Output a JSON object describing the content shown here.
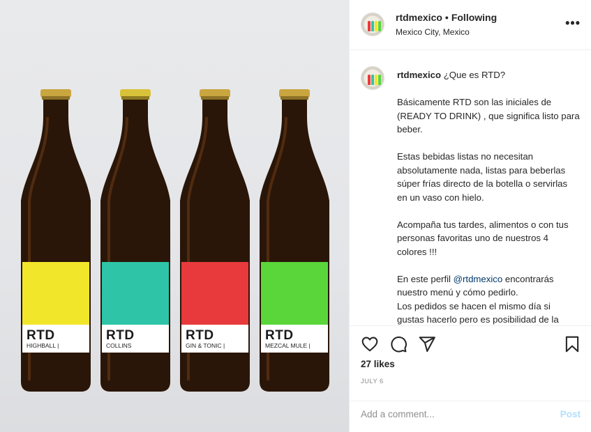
{
  "post": {
    "bottles": [
      {
        "brand": "RTD",
        "name": "HIGHBALL |",
        "color": "#f2e62b"
      },
      {
        "brand": "RTD",
        "name": "COLLINS",
        "color": "#2ec4a8"
      },
      {
        "brand": "RTD",
        "name": "GIN & TONIC |",
        "color": "#e83a3c"
      },
      {
        "brand": "RTD",
        "name": "MEZCAL MULE |",
        "color": "#5ad63a"
      }
    ]
  },
  "header": {
    "username": "rtdmexico",
    "separator": "•",
    "follow_status": "Following",
    "location": "Mexico City, Mexico",
    "more_icon": "more-horizontal-icon"
  },
  "caption": {
    "username": "rtdmexico",
    "title": "¿Que es RTD?",
    "p1": "Básicamente RTD son las iniciales de (READY TO DRINK) , que significa listo para beber.",
    "p2": "Estas bebidas listas no necesitan absolutamente nada, listas para beberlas súper frías directo de la botella o servirlas en un vaso con hielo.",
    "p3": "Acompaña tus tardes, alimentos o con tus personas favoritas uno de nuestros 4 colores !!!",
    "p4_before": "En este perfil ",
    "p4_mention": "@rtdmexico",
    "p4_after": " encontrarás nuestro menú y cómo pedirlo.",
    "p5": "Los pedidos se hacen el mismo día si gustas hacerlo pero es posibilidad de la"
  },
  "actions": {
    "icons": [
      "heart-icon",
      "comment-icon",
      "share-icon",
      "bookmark-icon"
    ],
    "likes": "27 likes",
    "date": "JULY 6"
  },
  "comment": {
    "placeholder": "Add a comment...",
    "post_label": "Post"
  },
  "colors": {
    "accent_blue": "#0095f6",
    "post_disabled": "#b2dffc",
    "mention": "#00376b"
  }
}
